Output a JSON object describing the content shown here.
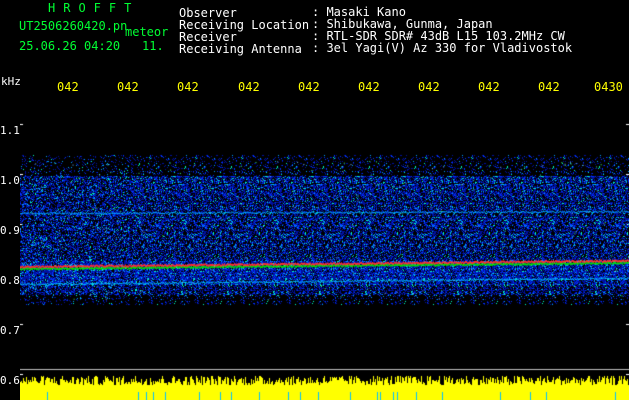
{
  "header": {
    "logo": "HROFFT",
    "filename": "UT2506260420.pn",
    "mode": "meteor",
    "datetime": "25.06.26 04:20",
    "counter": "11.",
    "observer_label": "Observer",
    "observer_value": ": Masaki Kano",
    "location_label": "Receiving Location",
    "location_value": ": Shibukawa, Gunma, Japan",
    "receiver_label": "Receiver",
    "receiver_value": ": RTL-SDR SDR# 43dB L15 103.2MHz CW",
    "antenna_label": "Receiving Antenna",
    "antenna_value": ": 3el Yagi(V) Az 330 for Vladivostok"
  },
  "axes": {
    "y_unit": "kHz",
    "y_ticks": [
      "1.1",
      "1.0",
      "0.9",
      "0.8",
      "0.7",
      "0.6"
    ],
    "x_ticks": [
      "042",
      "042",
      "042",
      "042",
      "042",
      "042",
      "042",
      "042",
      "042",
      "0430"
    ]
  },
  "colors": {
    "background": "#000000",
    "signal_strong": "#ff3030",
    "signal_mid": "#00e000",
    "noise": "#0030ff",
    "baseline_bar": "#ffff00",
    "text_green": "#00ff33",
    "text_yellow": "#ffff00"
  }
}
